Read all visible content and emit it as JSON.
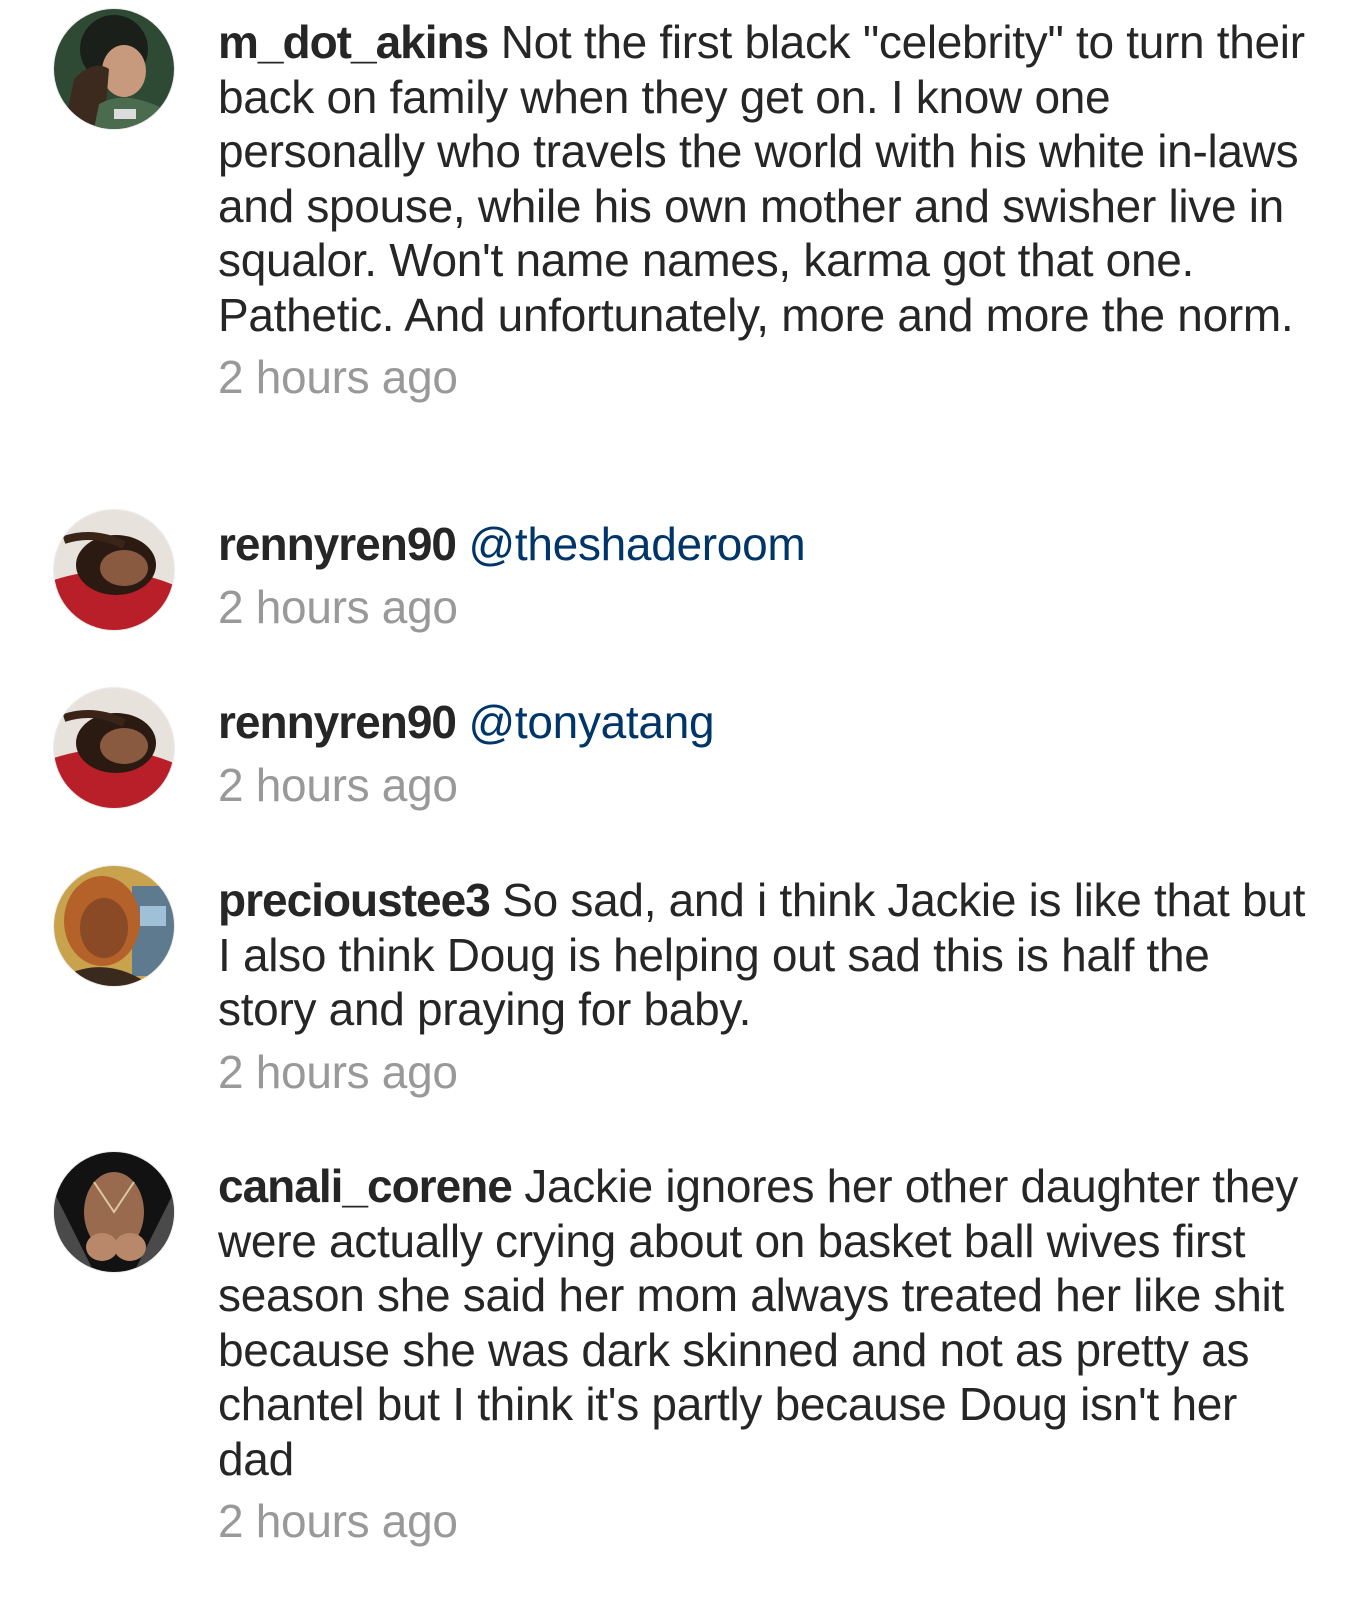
{
  "comments": [
    {
      "username": "m_dot_akins",
      "text": "Not the first black \"celebrity\" to turn their back on family when they get on. I know one personally who travels the world with his white in-laws and spouse, while his own mother and swisher live in squalor. Won't name names, karma got that one. Pathetic. And unfortunately, more and more the norm.",
      "timestamp": "2 hours ago"
    },
    {
      "username": "rennyren90",
      "mention": "@theshaderoom",
      "timestamp": "2 hours ago"
    },
    {
      "username": "rennyren90",
      "mention": "@tonyatang",
      "timestamp": "2 hours ago"
    },
    {
      "username": "precioustee3",
      "text": "So sad, and i think Jackie is like that but I also think Doug is helping out sad this is half the story and praying for baby.",
      "timestamp": "2 hours ago"
    },
    {
      "username": "canali_corene",
      "text": "Jackie ignores her other daughter they were actually crying about on basket ball wives first season she said her mom always treated her like shit because she was dark skinned and not as pretty as chantel but I think it's partly because Doug isn't her dad",
      "timestamp": "2 hours ago"
    }
  ],
  "colors": {
    "username": "#262626",
    "text": "#262626",
    "mention": "#003569",
    "timestamp": "#999999"
  }
}
